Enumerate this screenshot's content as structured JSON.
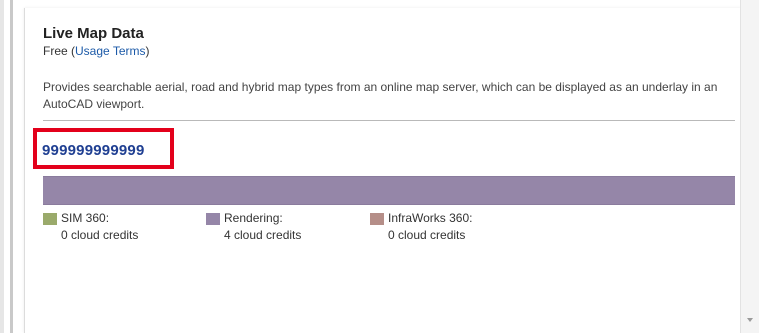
{
  "product": {
    "title": "Live Map Data",
    "price_prefix": "Free (",
    "usage_terms_link": "Usage Terms",
    "price_suffix": ")",
    "description": "Provides searchable aerial, road and hybrid map types from an online map server, which can be displayed as an underlay in an AutoCAD viewport."
  },
  "credits": {
    "total": "999999999999",
    "bar_color": "#9586a8",
    "legend": [
      {
        "name": "SIM 360:",
        "value": "0 cloud credits",
        "color": "#9aaa6b"
      },
      {
        "name": "Rendering:",
        "value": "4 cloud credits",
        "color": "#9586a8"
      },
      {
        "name": "InfraWorks 360:",
        "value": "0 cloud credits",
        "color": "#b58e88"
      }
    ]
  },
  "highlight_color": "#e3001b"
}
